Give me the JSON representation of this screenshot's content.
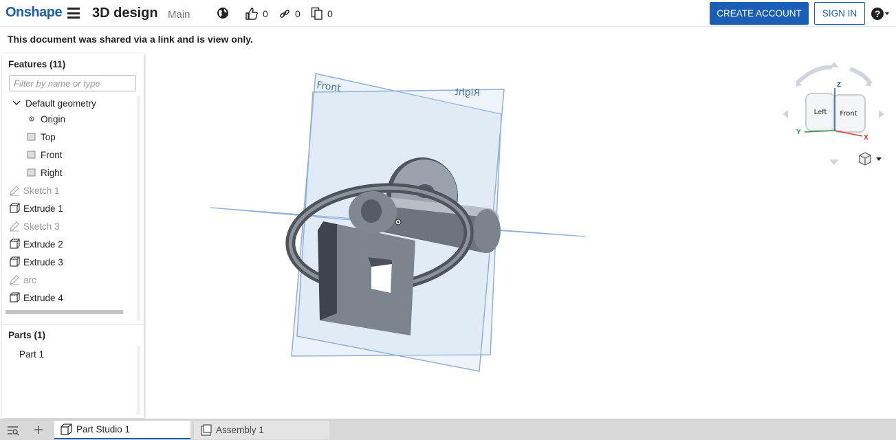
{
  "header": {
    "logo": "Onshape",
    "doc_title": "3D design",
    "branch": "Main",
    "likes": "0",
    "links": "0",
    "copies": "0",
    "create_account": "CREATE ACCOUNT",
    "sign_in": "SIGN IN"
  },
  "shared_message": "This document was shared via a link and is view only.",
  "features": {
    "heading": "Features (11)",
    "filter_placeholder": "Filter by name or type",
    "items": [
      {
        "label": "Default geometry",
        "type": "group"
      },
      {
        "label": "Origin",
        "type": "origin"
      },
      {
        "label": "Top",
        "type": "plane"
      },
      {
        "label": "Front",
        "type": "plane"
      },
      {
        "label": "Right",
        "type": "plane"
      },
      {
        "label": "Sketch 1",
        "type": "sketch"
      },
      {
        "label": "Extrude 1",
        "type": "extrude"
      },
      {
        "label": "Sketch 3",
        "type": "sketch"
      },
      {
        "label": "Extrude 2",
        "type": "extrude"
      },
      {
        "label": "Extrude 3",
        "type": "extrude"
      },
      {
        "label": "arc",
        "type": "sketch"
      },
      {
        "label": "Extrude 4",
        "type": "extrude"
      }
    ]
  },
  "parts": {
    "heading": "Parts (1)",
    "items": [
      "Part 1"
    ]
  },
  "viewport": {
    "plane_front_label": "Front",
    "plane_right_label": "Right",
    "cube_left": "Left",
    "cube_front": "Front",
    "axis_x": "X",
    "axis_y": "Y",
    "axis_z": "Z"
  },
  "tabs": [
    {
      "label": "Part Studio 1",
      "active": true
    },
    {
      "label": "Assembly 1",
      "active": false
    }
  ],
  "colors": {
    "brand": "#1a5fb4",
    "plane_stroke": "#8fb0d8",
    "part_body": "#5f6670"
  }
}
